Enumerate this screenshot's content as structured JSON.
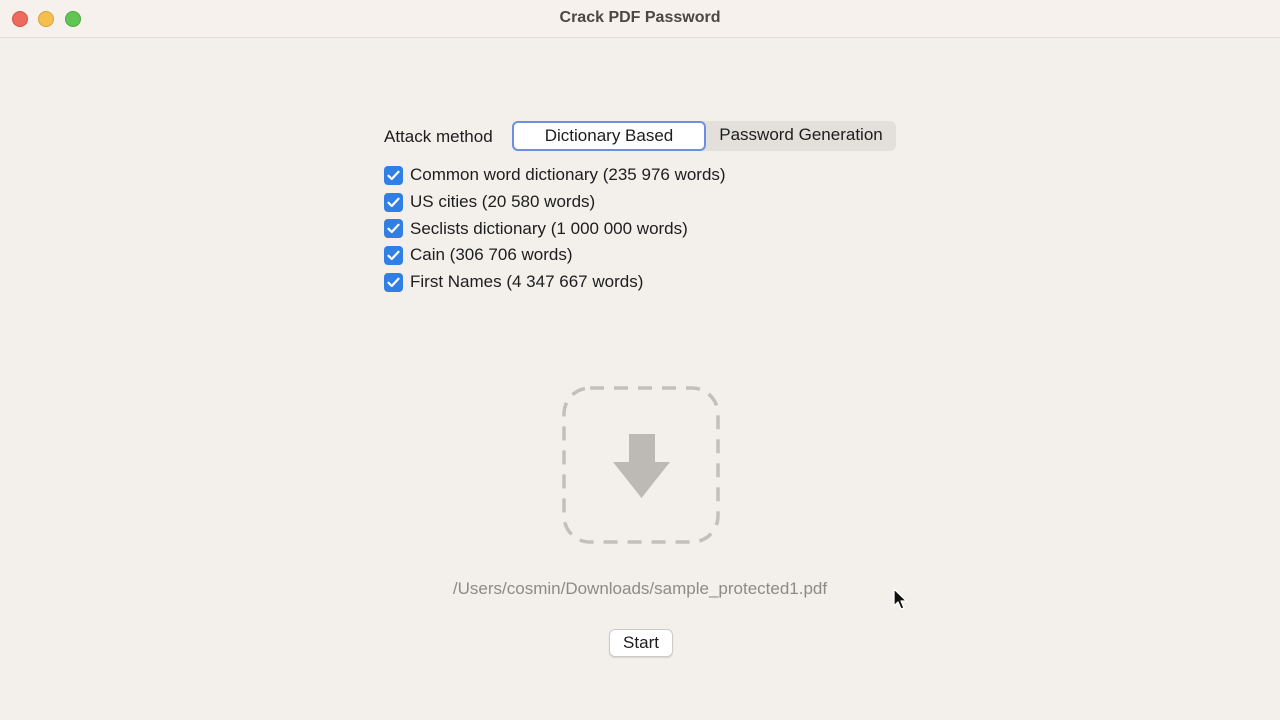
{
  "window": {
    "title": "Crack PDF Password"
  },
  "attack": {
    "label": "Attack method",
    "options": [
      "Dictionary Based",
      "Password Generation"
    ],
    "selected": "Dictionary Based"
  },
  "dictionaries": [
    {
      "label": "Common word dictionary (235 976 words)",
      "checked": true
    },
    {
      "label": "US cities (20 580 words)",
      "checked": true
    },
    {
      "label": "Seclists dictionary (1 000 000 words)",
      "checked": true
    },
    {
      "label": "Cain (306 706 words)",
      "checked": true
    },
    {
      "label": "First Names (4 347 667 words)",
      "checked": true
    }
  ],
  "dropzone": {
    "icon": "download-arrow-icon"
  },
  "file_path": "/Users/cosmin/Downloads/sample_protected1.pdf",
  "start_label": "Start",
  "colors": {
    "accent": "#2f7fe4",
    "focus_ring": "#6c8fe0",
    "background": "#f3efea"
  }
}
